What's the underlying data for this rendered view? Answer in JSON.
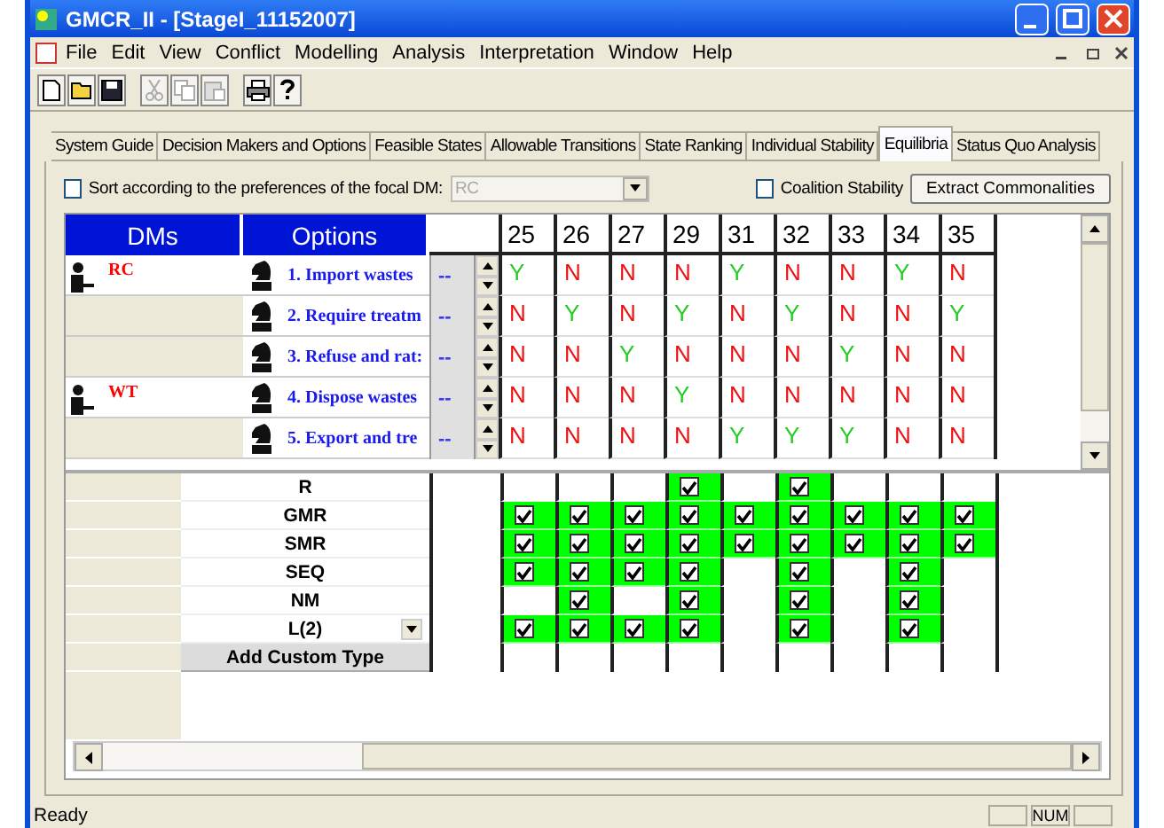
{
  "window": {
    "title": "GMCR_II - [StageI_11152007]"
  },
  "menu": [
    "File",
    "Edit",
    "View",
    "Conflict",
    "Modelling",
    "Analysis",
    "Interpretation",
    "Window",
    "Help"
  ],
  "toolbar": [
    {
      "kind": "new",
      "disabled": false
    },
    {
      "kind": "open",
      "disabled": false
    },
    {
      "kind": "save",
      "disabled": false
    },
    {
      "kind": "cut",
      "disabled": true
    },
    {
      "kind": "copy",
      "disabled": true
    },
    {
      "kind": "paste",
      "disabled": true
    },
    {
      "kind": "print",
      "disabled": false
    },
    {
      "kind": "help",
      "disabled": false
    }
  ],
  "tabs": [
    {
      "label": "System Guide",
      "selected": false
    },
    {
      "label": "Decision Makers and Options",
      "selected": false
    },
    {
      "label": "Feasible States",
      "selected": false
    },
    {
      "label": "Allowable Transitions",
      "selected": false
    },
    {
      "label": "State Ranking",
      "selected": false
    },
    {
      "label": "Individual Stability",
      "selected": false
    },
    {
      "label": "Equilibria",
      "selected": true
    },
    {
      "label": "Status Quo Analysis",
      "selected": false
    }
  ],
  "sort_option": {
    "label": "Sort according to the preferences of the focal DM:",
    "checked": false,
    "focal_dm": "RC",
    "disabled": true
  },
  "coalition_option": {
    "label": "Coalition Stability",
    "checked": false
  },
  "extract_button": "Extract Commonalities",
  "grid": {
    "dms_header": "DMs",
    "options_header": "Options",
    "states": [
      "25",
      "26",
      "27",
      "29",
      "31",
      "32",
      "33",
      "34",
      "35"
    ],
    "rows": [
      {
        "dm": "RC",
        "option": "1. Import wastes",
        "status": "--",
        "cells": [
          {
            "value": "Y",
            "color": "#22cc22"
          },
          {
            "value": "N",
            "color": "#ee1111"
          },
          {
            "value": "N",
            "color": "#ee1111"
          },
          {
            "value": "N",
            "color": "#ee1111"
          },
          {
            "value": "Y",
            "color": "#22cc22"
          },
          {
            "value": "N",
            "color": "#ee1111"
          },
          {
            "value": "N",
            "color": "#ee1111"
          },
          {
            "value": "Y",
            "color": "#22cc22"
          },
          {
            "value": "N",
            "color": "#ee1111"
          }
        ]
      },
      {
        "option": "2. Require treatm",
        "status": "--",
        "cells": [
          {
            "value": "N",
            "color": "#ee1111"
          },
          {
            "value": "Y",
            "color": "#22cc22"
          },
          {
            "value": "N",
            "color": "#ee1111"
          },
          {
            "value": "Y",
            "color": "#22cc22"
          },
          {
            "value": "N",
            "color": "#ee1111"
          },
          {
            "value": "Y",
            "color": "#22cc22"
          },
          {
            "value": "N",
            "color": "#ee1111"
          },
          {
            "value": "N",
            "color": "#ee1111"
          },
          {
            "value": "Y",
            "color": "#22cc22"
          }
        ]
      },
      {
        "option": "3. Refuse and rat:",
        "status": "--",
        "cells": [
          {
            "value": "N",
            "color": "#ee1111"
          },
          {
            "value": "N",
            "color": "#ee1111"
          },
          {
            "value": "Y",
            "color": "#22cc22"
          },
          {
            "value": "N",
            "color": "#ee1111"
          },
          {
            "value": "N",
            "color": "#ee1111"
          },
          {
            "value": "N",
            "color": "#ee1111"
          },
          {
            "value": "Y",
            "color": "#22cc22"
          },
          {
            "value": "N",
            "color": "#ee1111"
          },
          {
            "value": "N",
            "color": "#ee1111"
          }
        ]
      },
      {
        "dm": "WT",
        "option": "4. Dispose wastes",
        "status": "--",
        "cells": [
          {
            "value": "N",
            "color": "#ee1111"
          },
          {
            "value": "N",
            "color": "#ee1111"
          },
          {
            "value": "N",
            "color": "#ee1111"
          },
          {
            "value": "Y",
            "color": "#22cc22"
          },
          {
            "value": "N",
            "color": "#ee1111"
          },
          {
            "value": "N",
            "color": "#ee1111"
          },
          {
            "value": "N",
            "color": "#ee1111"
          },
          {
            "value": "N",
            "color": "#ee1111"
          },
          {
            "value": "N",
            "color": "#ee1111"
          }
        ]
      },
      {
        "option": "5. Export and tre",
        "status": "--",
        "cells": [
          {
            "value": "N",
            "color": "#ee1111"
          },
          {
            "value": "N",
            "color": "#ee1111"
          },
          {
            "value": "N",
            "color": "#ee1111"
          },
          {
            "value": "N",
            "color": "#ee1111"
          },
          {
            "value": "Y",
            "color": "#22cc22"
          },
          {
            "value": "Y",
            "color": "#22cc22"
          },
          {
            "value": "Y",
            "color": "#22cc22"
          },
          {
            "value": "N",
            "color": "#ee1111"
          },
          {
            "value": "N",
            "color": "#ee1111"
          }
        ]
      }
    ]
  },
  "stability": {
    "rows": [
      {
        "kind": "plain",
        "label": "R",
        "checked": [
          false,
          false,
          false,
          true,
          false,
          true,
          false,
          false,
          false
        ]
      },
      {
        "kind": "plain",
        "label": "GMR",
        "checked": [
          true,
          true,
          true,
          true,
          true,
          true,
          true,
          true,
          true
        ]
      },
      {
        "kind": "plain",
        "label": "SMR",
        "checked": [
          true,
          true,
          true,
          true,
          true,
          true,
          true,
          true,
          true
        ]
      },
      {
        "kind": "plain",
        "label": "SEQ",
        "checked": [
          true,
          true,
          true,
          true,
          false,
          true,
          false,
          true,
          false
        ]
      },
      {
        "kind": "plain",
        "label": "NM",
        "checked": [
          false,
          true,
          false,
          true,
          false,
          true,
          false,
          true,
          false
        ]
      },
      {
        "kind": "dropdown",
        "label": "L(2)",
        "checked": [
          true,
          true,
          true,
          true,
          false,
          true,
          false,
          true,
          false
        ]
      }
    ],
    "add_button": "Add Custom Type"
  },
  "status_bar": {
    "message": "Ready",
    "num": "NUM"
  }
}
